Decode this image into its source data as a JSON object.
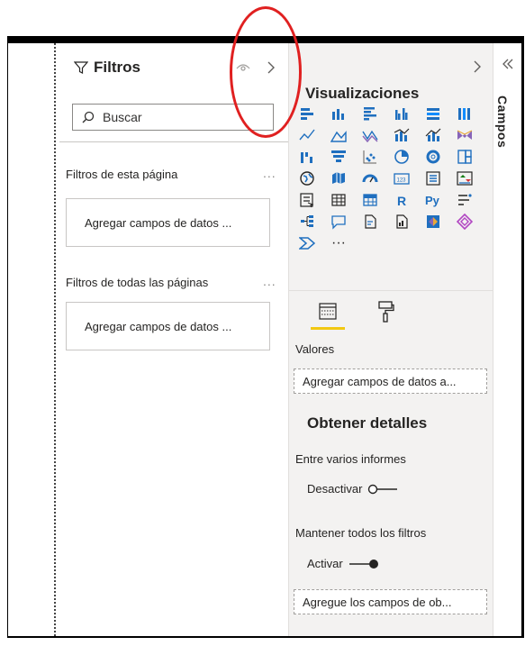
{
  "filters": {
    "title": "Filtros",
    "search_placeholder": "Buscar",
    "page_section": "Filtros de esta página",
    "all_pages_section": "Filtros de todas las páginas",
    "page_dropzone": "Agregar campos de datos ...",
    "all_dropzone": "Agregar campos de datos ...",
    "ellipsis": "..."
  },
  "visualizations": {
    "title": "Visualizaciones",
    "more": "···",
    "values_label": "Valores",
    "values_dropzone": "Agregar campos de datos a...",
    "drill_heading": "Obtener detalles",
    "cross_report_label": "Entre varios informes",
    "cross_report_toggle": "Desactivar",
    "keep_filters_label": "Mantener todos los filtros",
    "keep_filters_toggle": "Activar",
    "drill_dropzone": "Agregue los campos de ob..."
  },
  "fields": {
    "title": "Campos"
  },
  "colors": {
    "accent": "#f2c811",
    "annotation": "#e02020",
    "icon_blue": "#1f6fbf",
    "icon_teal": "#118dff"
  }
}
